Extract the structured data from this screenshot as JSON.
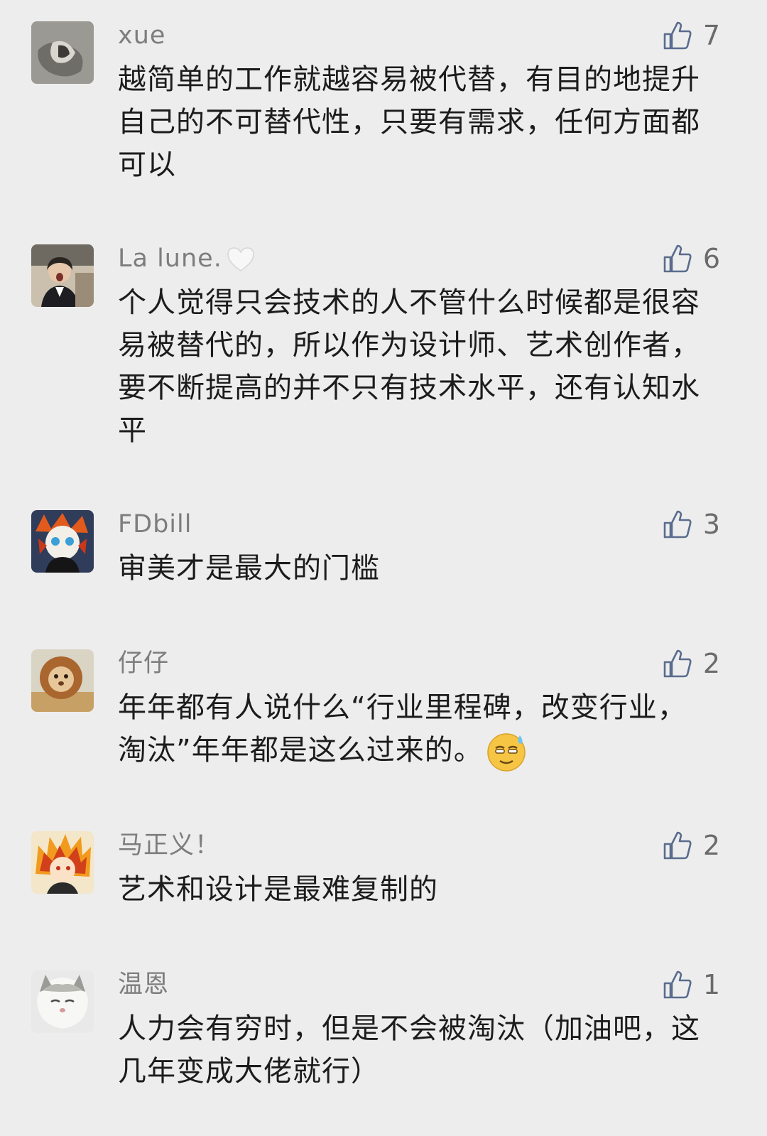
{
  "comments": [
    {
      "username": "xue",
      "likes": "7",
      "text": "越简单的工作就越容易被代替，有目的地提升自己的不可替代性，只要有需求，任何方面都可以"
    },
    {
      "username": "La lune.",
      "username_emoji": "white-heart-icon",
      "likes": "6",
      "text": "个人觉得只会技术的人不管什么时候都是很容易被替代的，所以作为设计师、艺术创作者，要不断提高的并不只有技术水平，还有认知水平"
    },
    {
      "username": "FDbill",
      "likes": "3",
      "text": "审美才是最大的门槛"
    },
    {
      "username": "仔仔",
      "likes": "2",
      "text": "年年都有人说什么“行业里程碑，改变行业，淘汰”年年都是这么过来的。",
      "text_emoji": "sweat-smile-emoji-icon"
    },
    {
      "username": "马正义！",
      "likes": "2",
      "text": "艺术和设计是最难复制的"
    },
    {
      "username": "温恩",
      "likes": "1",
      "text": "人力会有穷时，但是不会被淘汰（加油吧，这几年变成大佬就行）"
    }
  ],
  "colors": {
    "background": "#ededed",
    "username": "#7d7d7d",
    "like_icon": "#5a6c8e",
    "text": "#1c1c1c"
  }
}
